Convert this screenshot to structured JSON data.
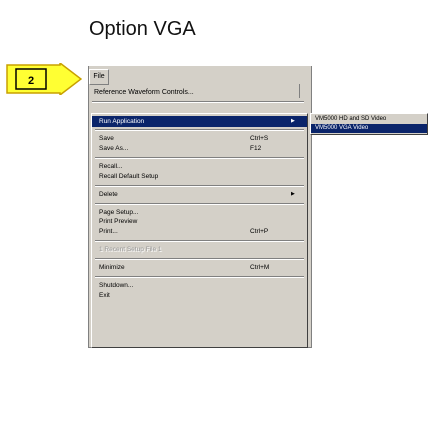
{
  "heading": "Option VGA",
  "step": {
    "number": "2"
  },
  "colors": {
    "callout_fill": "#ffff33",
    "callout_stroke": "#c8a000",
    "highlight": "#0a246a",
    "menu_bg": "#d4d0c8"
  },
  "menubar": {
    "file_label": "File"
  },
  "top_item": "Reference Waveform Controls...",
  "menu": {
    "items": [
      {
        "label": "Run Application",
        "shortcut": "",
        "arrow": "▶",
        "state": "highlight"
      },
      {
        "label": "Save",
        "shortcut": "Ctrl+S",
        "arrow": "",
        "state": "normal"
      },
      {
        "label": "Save As...",
        "shortcut": "F12",
        "arrow": "",
        "state": "normal"
      },
      {
        "label": "Recall...",
        "shortcut": "",
        "arrow": "",
        "state": "normal"
      },
      {
        "label": "Recall Default Setup",
        "shortcut": "",
        "arrow": "",
        "state": "normal"
      },
      {
        "label": "Delete",
        "shortcut": "",
        "arrow": "▶",
        "state": "normal"
      },
      {
        "label": "Page Setup...",
        "shortcut": "",
        "arrow": "",
        "state": "normal"
      },
      {
        "label": "Print Preview",
        "shortcut": "",
        "arrow": "",
        "state": "normal"
      },
      {
        "label": "Print...",
        "shortcut": "Ctrl+P",
        "arrow": "",
        "state": "normal"
      },
      {
        "label": "1 Recent Setup File 1",
        "shortcut": "",
        "arrow": "",
        "state": "disabled"
      },
      {
        "label": "Minimize",
        "shortcut": "Ctrl+M",
        "arrow": "",
        "state": "normal"
      },
      {
        "label": "Shutdown...",
        "shortcut": "",
        "arrow": "",
        "state": "normal"
      },
      {
        "label": "Exit",
        "shortcut": "",
        "arrow": "",
        "state": "normal"
      }
    ]
  },
  "submenu": {
    "items": [
      {
        "label": "VM5000 HD and SD Video",
        "state": "normal"
      },
      {
        "label": "VM5000 VGA Video",
        "state": "highlight"
      }
    ]
  }
}
